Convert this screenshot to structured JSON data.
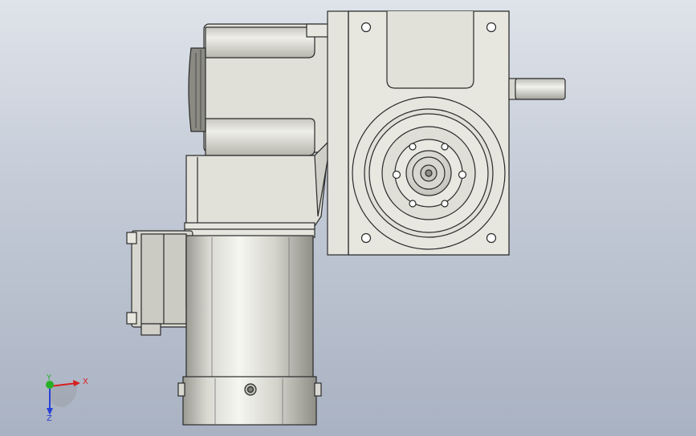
{
  "viewport": {
    "background_top": "#dfe3ea",
    "background_bottom": "#a9b2c2"
  },
  "model": {
    "body_color": "#e3e3dc",
    "edge_color": "#2a2a2a",
    "shade_color": "#c9c9c1"
  },
  "triad": {
    "x_label": "X",
    "y_label": "Y",
    "z_label": "Z",
    "x_color": "#d62020",
    "y_color": "#27b027",
    "z_color": "#2a3fd8"
  }
}
